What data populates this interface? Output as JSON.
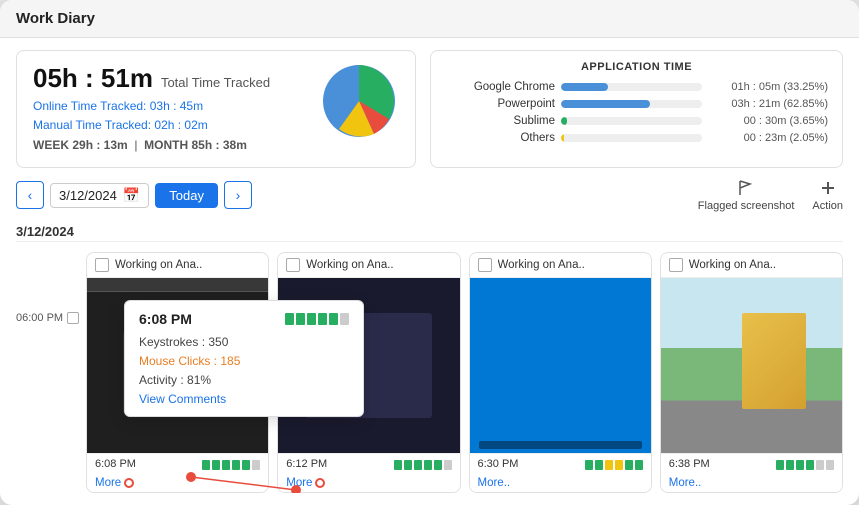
{
  "window": {
    "title": "Work Diary"
  },
  "stats": {
    "total_time": "05h : 51m",
    "total_label": "Total Time Tracked",
    "online_label": "Online Time Tracked:",
    "online_value": "03h : 45m",
    "manual_label": "Manual Time Tracked:",
    "manual_value": "02h : 02m",
    "week_label": "WEEK",
    "week_value": "29h : 13m",
    "month_label": "MONTH",
    "month_value": "85h : 38m"
  },
  "app_time": {
    "title": "APPLICATION TIME",
    "apps": [
      {
        "name": "Google Chrome",
        "bar_pct": 33,
        "bar_color": "#4a90d9",
        "time": "01h : 05m (33.25%)"
      },
      {
        "name": "Powerpoint",
        "bar_pct": 63,
        "bar_color": "#4a90d9",
        "time": "03h : 21m (62.85%)"
      },
      {
        "name": "Sublime",
        "bar_pct": 4,
        "bar_color": "#27ae60",
        "time": "00 : 30m (3.65%)"
      },
      {
        "name": "Others",
        "bar_pct": 2,
        "bar_color": "#f1c40f",
        "time": "00 : 23m (2.05%)"
      }
    ]
  },
  "controls": {
    "date_value": "3/12/2024",
    "today_label": "Today",
    "prev_arrow": "‹",
    "next_arrow": "›",
    "flagged_label": "Flagged screenshot",
    "action_label": "Action"
  },
  "date_heading": "3/12/2024",
  "time_label": "06:00 PM",
  "screenshots": [
    {
      "title": "Working on Ana..",
      "time": "6:08 PM",
      "more_text": "More",
      "thumb_type": "dark"
    },
    {
      "title": "Working on Ana..",
      "time": "6:12 PM",
      "more_text": "More",
      "thumb_type": "dark2"
    },
    {
      "title": "Working on Ana..",
      "time": "6:30 PM",
      "more_text": "More..",
      "thumb_type": "desktop"
    },
    {
      "title": "Working on Ana..",
      "time": "6:38 PM",
      "more_text": "More..",
      "thumb_type": "photo"
    }
  ],
  "tooltip": {
    "time": "6:08 PM",
    "keystrokes_label": "Keystrokes :",
    "keystrokes_value": "350",
    "mouse_label": "Mouse Clicks :",
    "mouse_value": "185",
    "activity_label": "Activity :",
    "activity_value": "81%",
    "view_comments": "View Comments"
  },
  "activity_colors": {
    "green": "#27ae60",
    "yellow": "#f1c40f",
    "red": "#e74c3c",
    "gray": "#ccc"
  }
}
